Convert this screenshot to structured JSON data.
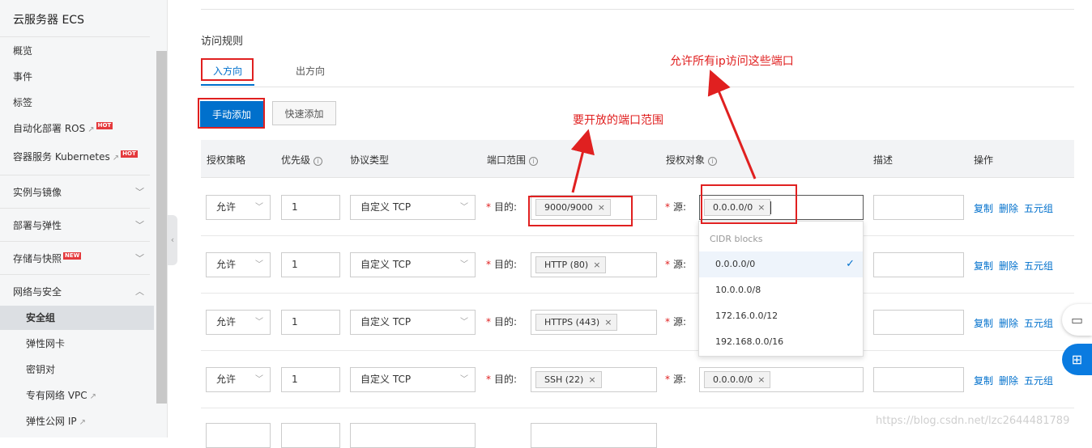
{
  "sidebar": {
    "title": "云服务器 ECS",
    "items": [
      {
        "label": "概览"
      },
      {
        "label": "事件"
      },
      {
        "label": "标签"
      },
      {
        "label": "自动化部署 ROS",
        "badge": "HOT"
      },
      {
        "label": "容器服务 Kubernetes",
        "badge": "HOT"
      }
    ],
    "groups": [
      {
        "label": "实例与镜像"
      },
      {
        "label": "部署与弹性"
      },
      {
        "label": "存储与快照",
        "badge": "NEW"
      },
      {
        "label": "网络与安全"
      }
    ],
    "sub_items": [
      {
        "label": "安全组"
      },
      {
        "label": "弹性网卡"
      },
      {
        "label": "密钥对"
      },
      {
        "label": "专有网络 VPC"
      },
      {
        "label": "弹性公网 IP"
      }
    ]
  },
  "main": {
    "title": "访问规则",
    "tabs": [
      {
        "label": "入方向"
      },
      {
        "label": "出方向"
      }
    ],
    "buttons": {
      "manual_add": "手动添加",
      "quick_add": "快速添加"
    },
    "columns": [
      "授权策略",
      "优先级",
      "协议类型",
      "端口范围",
      "授权对象",
      "描述",
      "操作"
    ],
    "dest_label": "目的:",
    "src_label": "源:",
    "actions": [
      "复制",
      "删除",
      "五元组"
    ],
    "rows": [
      {
        "policy": "允许",
        "priority": "1",
        "protocol": "自定义 TCP",
        "port": "9000/9000",
        "source": "0.0.0.0/0"
      },
      {
        "policy": "允许",
        "priority": "1",
        "protocol": "自定义 TCP",
        "port": "HTTP (80)",
        "source": ""
      },
      {
        "policy": "允许",
        "priority": "1",
        "protocol": "自定义 TCP",
        "port": "HTTPS (443)",
        "source": ""
      },
      {
        "policy": "允许",
        "priority": "1",
        "protocol": "自定义 TCP",
        "port": "SSH (22)",
        "source": "0.0.0.0/0"
      }
    ],
    "dropdown": {
      "header": "CIDR blocks",
      "options": [
        "0.0.0.0/0",
        "10.0.0.0/8",
        "172.16.0.0/12",
        "192.168.0.0/16"
      ],
      "selected": "0.0.0.0/0"
    }
  },
  "annotations": {
    "port_note": "要开放的端口范围",
    "ip_note": "允许所有ip访问这些端口"
  },
  "watermark": "https://blog.csdn.net/lzc2644481789",
  "colors": {
    "primary": "#0070cc",
    "annotation": "#e02020"
  }
}
